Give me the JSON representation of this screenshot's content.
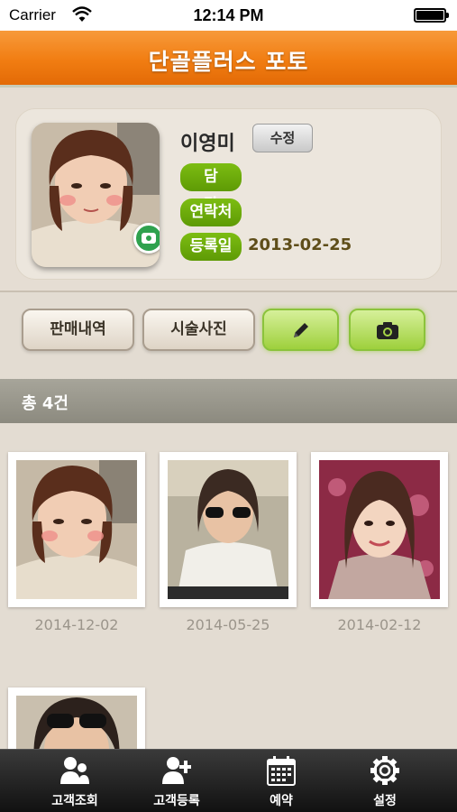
{
  "status_bar": {
    "carrier": "Carrier",
    "time": "12:14 PM"
  },
  "nav": {
    "title": "단골플러스 포토"
  },
  "profile": {
    "name": "이영미",
    "edit_label": "수정",
    "tag_manager": "담 당",
    "tag_contact": "연락처",
    "tag_registered": "등록일",
    "registered_date": "2013-02-25"
  },
  "actions": {
    "sales_history": "판매내역",
    "treatment_photos": "시술사진"
  },
  "summary": {
    "count_text": "총 4건"
  },
  "gallery": {
    "photos": [
      {
        "date": "2014-12-02"
      },
      {
        "date": "2014-05-25"
      },
      {
        "date": "2014-02-12"
      },
      {
        "date": ""
      }
    ]
  },
  "tabbar": {
    "items": [
      {
        "label": "고객조회",
        "icon": "customers-icon"
      },
      {
        "label": "고객등록",
        "icon": "add-customer-icon"
      },
      {
        "label": "예약",
        "icon": "calendar-icon"
      },
      {
        "label": "설정",
        "icon": "gear-icon"
      }
    ]
  },
  "colors": {
    "nav_orange": "#f17d12",
    "tag_green": "#6aa80a",
    "action_green": "#9ed03c"
  }
}
